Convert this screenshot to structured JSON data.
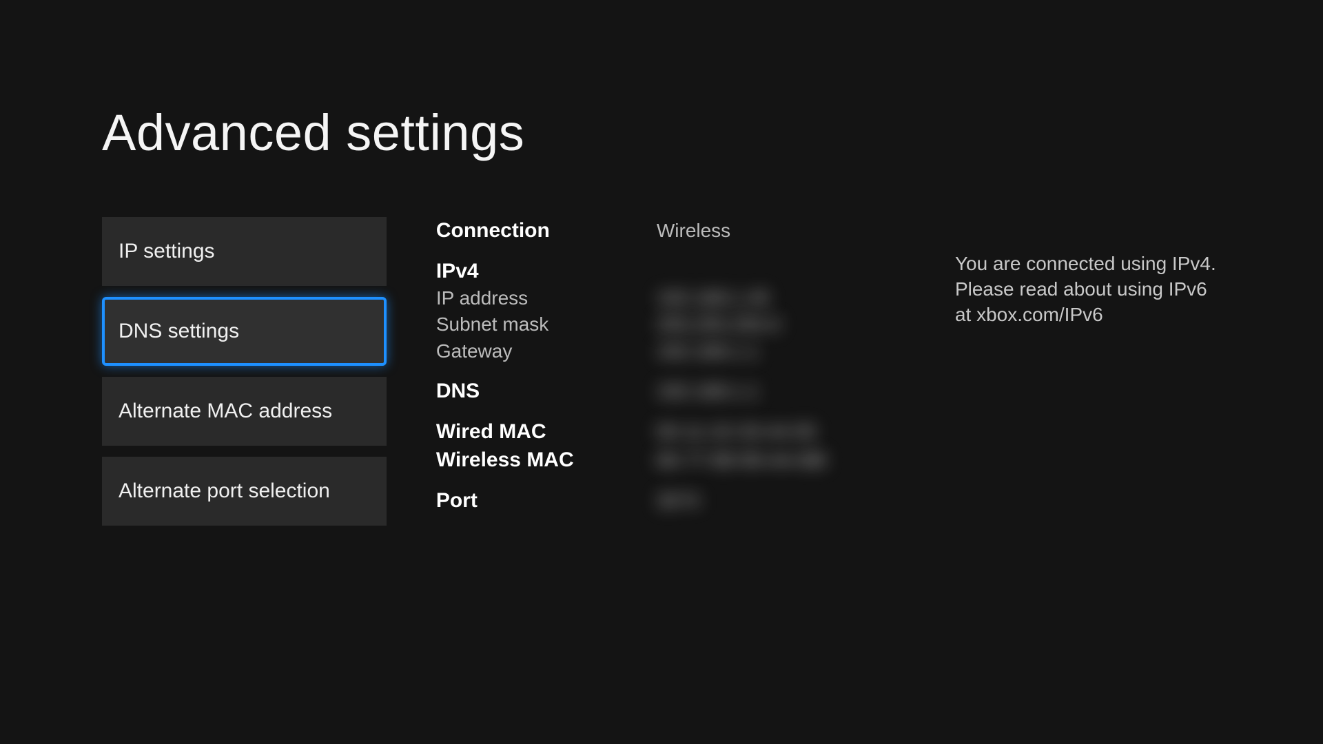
{
  "page": {
    "title": "Advanced settings"
  },
  "sidebar": {
    "items": [
      {
        "label": "IP settings",
        "focused": false
      },
      {
        "label": "DNS settings",
        "focused": true
      },
      {
        "label": "Alternate MAC address",
        "focused": false
      },
      {
        "label": "Alternate port selection",
        "focused": false
      }
    ]
  },
  "details": {
    "connection_label": "Connection",
    "connection_value": "Wireless",
    "ipv4_label": "IPv4",
    "ip_address_label": "IP address",
    "ip_address_value": "192.168.1.45",
    "subnet_mask_label": "Subnet mask",
    "subnet_mask_value": "255.255.255.0",
    "gateway_label": "Gateway",
    "gateway_value": "192.168.1.1",
    "dns_label": "DNS",
    "dns_value": "192.168.1.1",
    "wired_mac_label": "Wired MAC",
    "wired_mac_value": "00-11-22-33-44-55",
    "wireless_mac_label": "Wireless MAC",
    "wireless_mac_value": "66-77-88-99-AA-BB",
    "port_label": "Port",
    "port_value": "3074"
  },
  "info": {
    "text": "You are connected using IPv4. Please read about using IPv6 at xbox.com/IPv6"
  }
}
